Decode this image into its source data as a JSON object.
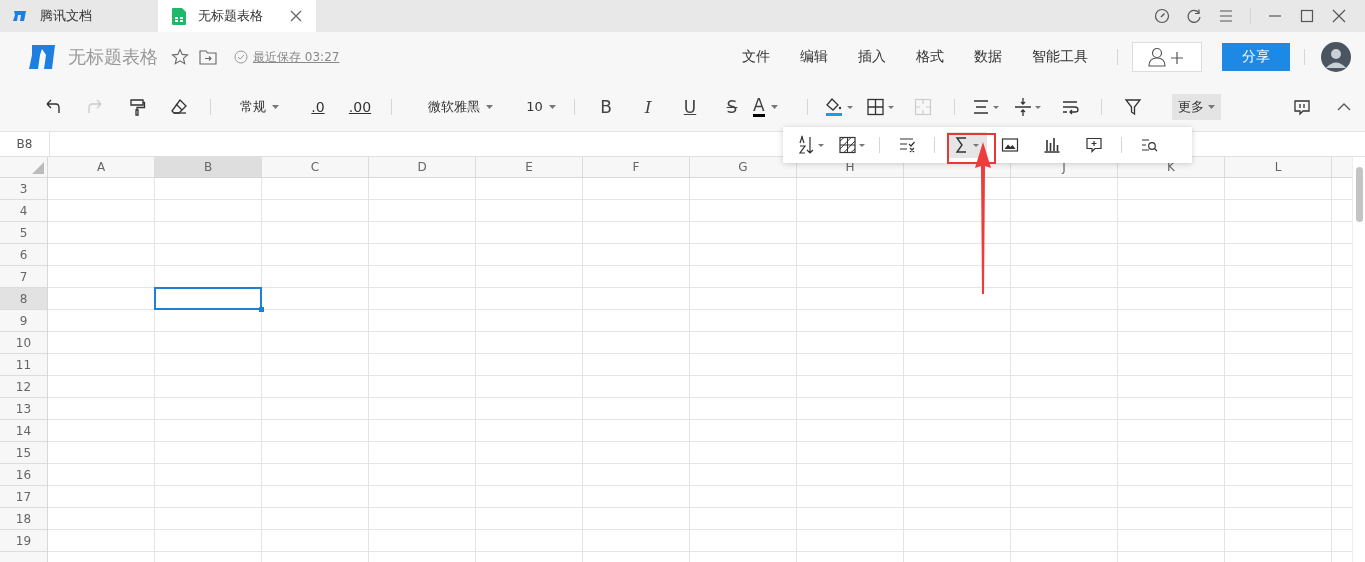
{
  "tabs": [
    {
      "label": "腾讯文档",
      "selected": false,
      "kind": "home"
    },
    {
      "label": "无标题表格",
      "selected": true,
      "kind": "sheet"
    }
  ],
  "header": {
    "title": "无标题表格",
    "save_status": "最近保存 03:27",
    "menus": [
      "文件",
      "编辑",
      "插入",
      "格式",
      "数据",
      "智能工具"
    ],
    "share_button": "分享"
  },
  "toolbar": {
    "redo": {
      "disabled": true
    },
    "number_format": "常规",
    "decrease_decimal": ".0",
    "increase_decimal": ".00",
    "font": "微软雅黑",
    "font_size": "10",
    "bold": "B",
    "italic": "I",
    "underline": "U",
    "strikethrough": "S",
    "font_color": "A",
    "merge": {
      "disabled": true
    },
    "more": {
      "label": "更多",
      "expanded": true
    }
  },
  "name_box": "B8",
  "columns": [
    {
      "label": "A",
      "selected": false
    },
    {
      "label": "B",
      "selected": true
    },
    {
      "label": "C",
      "selected": false
    },
    {
      "label": "D",
      "selected": false
    },
    {
      "label": "E",
      "selected": false
    },
    {
      "label": "F",
      "selected": false
    },
    {
      "label": "G",
      "selected": false
    },
    {
      "label": "H",
      "selected": false
    },
    {
      "selected": false
    },
    {
      "label": "J",
      "selected": false
    },
    {
      "label": "K",
      "selected": false
    },
    {
      "label": "L",
      "selected": false
    }
  ],
  "rows": [
    {
      "label": "3",
      "selected": false
    },
    {
      "label": "4",
      "selected": false
    },
    {
      "label": "5",
      "selected": false
    },
    {
      "label": "6",
      "selected": false
    },
    {
      "label": "7",
      "selected": false
    },
    {
      "label": "8",
      "selected": true
    },
    {
      "label": "9",
      "selected": false
    },
    {
      "label": "10",
      "selected": false
    },
    {
      "label": "11",
      "selected": false
    },
    {
      "label": "12",
      "selected": false
    },
    {
      "label": "13",
      "selected": false
    },
    {
      "label": "14",
      "selected": false
    },
    {
      "label": "15",
      "selected": false
    },
    {
      "label": "16",
      "selected": false
    },
    {
      "label": "17",
      "selected": false
    },
    {
      "label": "18",
      "selected": false
    },
    {
      "label": "19",
      "selected": false
    }
  ]
}
